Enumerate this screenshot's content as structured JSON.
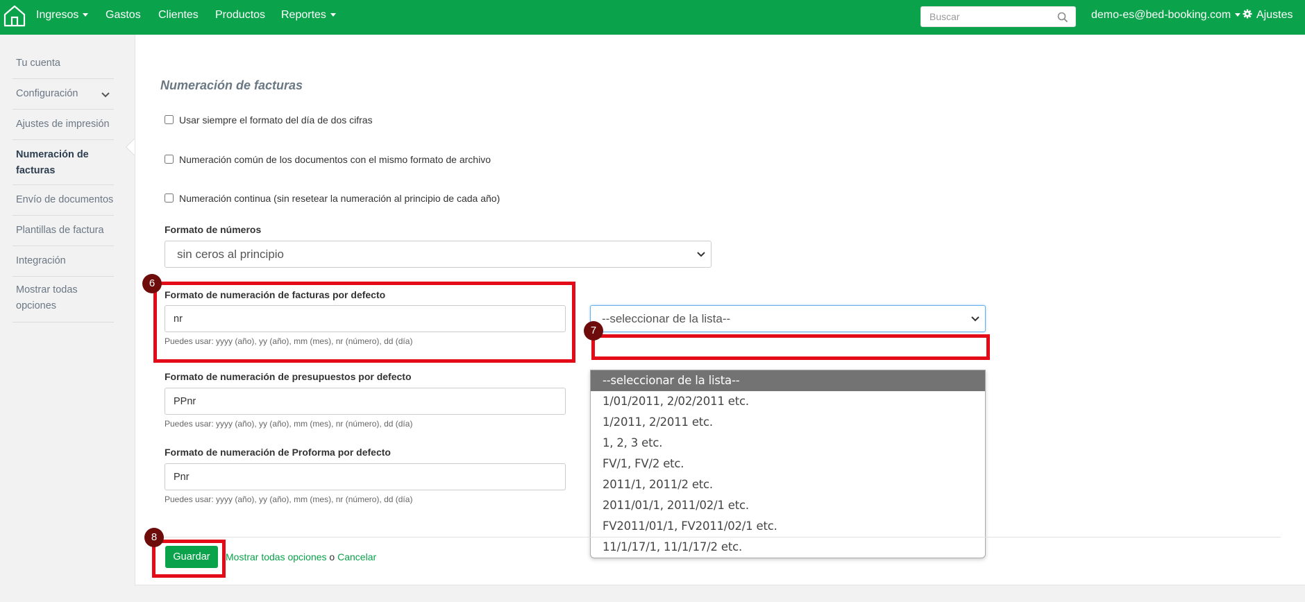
{
  "nav": {
    "items": [
      {
        "label": "Ingresos",
        "dropdown": true
      },
      {
        "label": "Gastos",
        "dropdown": false
      },
      {
        "label": "Clientes",
        "dropdown": false
      },
      {
        "label": "Productos",
        "dropdown": false
      },
      {
        "label": "Reportes",
        "dropdown": true
      }
    ],
    "search_placeholder": "Buscar",
    "user": "demo-es@bed-booking.com",
    "settings": "Ajustes",
    "accent_color": "#0aa24a"
  },
  "sidebar": {
    "items": [
      {
        "label": "Tu cuenta"
      },
      {
        "label": "Configuración"
      },
      {
        "label": "Ajustes de impresión"
      },
      {
        "label": "Numeración de facturas",
        "active": true
      },
      {
        "label": "Envío de documentos"
      },
      {
        "label": "Plantillas de factura"
      },
      {
        "label": "Integración"
      },
      {
        "label": "Mostrar todas opciones"
      }
    ]
  },
  "main": {
    "title": "Numeración de facturas",
    "checkboxes": [
      {
        "label": "Usar siempre el formato del día de dos cifras",
        "checked": false
      },
      {
        "label": "Numeración común de los documentos con el mismo formato de archivo",
        "checked": false
      },
      {
        "label": "Numeración continua (sin resetear la numeración al principio de cada año)",
        "checked": false
      }
    ],
    "number_format": {
      "label": "Formato de números",
      "value": "sin ceros al principio"
    },
    "invoice_format": {
      "label": "Formato de numeración de facturas por defecto",
      "value": "nr",
      "help": "Puedes usar: yyyy (año), yy (año), mm (mes), nr (número), dd (día)",
      "select_value": "--seleccionar de la lista--"
    },
    "quote_format": {
      "label": "Formato de numeración de presupuestos por defecto",
      "value": "PPnr",
      "help": "Puedes usar: yyyy (año), yy (año), mm (mes), nr (número), dd (día)"
    },
    "proforma_format": {
      "label": "Formato de numeración de Proforma por defecto",
      "value": "Pnr",
      "help": "Puedes usar: yyyy (año), yy (año), mm (mes), nr (número), dd (día)"
    },
    "dropdown_options": [
      "--seleccionar de la lista--",
      "1/01/2011, 2/02/2011 etc.",
      "1/2011, 2/2011 etc.",
      "1, 2, 3 etc.",
      "FV/1, FV/2 etc.",
      "2011/1, 2011/2 etc.",
      "2011/01/1, 2011/02/1 etc.",
      "FV2011/01/1, FV2011/02/1 etc.",
      "11/1/17/1, 11/1/17/2 etc."
    ],
    "save_label": "Guardar",
    "show_all_label": "Mostrar todas opciones",
    "or_label": "o",
    "cancel_label": "Cancelar"
  },
  "annotations": {
    "badges": [
      "6",
      "7",
      "8"
    ],
    "color": "#e30b17"
  }
}
